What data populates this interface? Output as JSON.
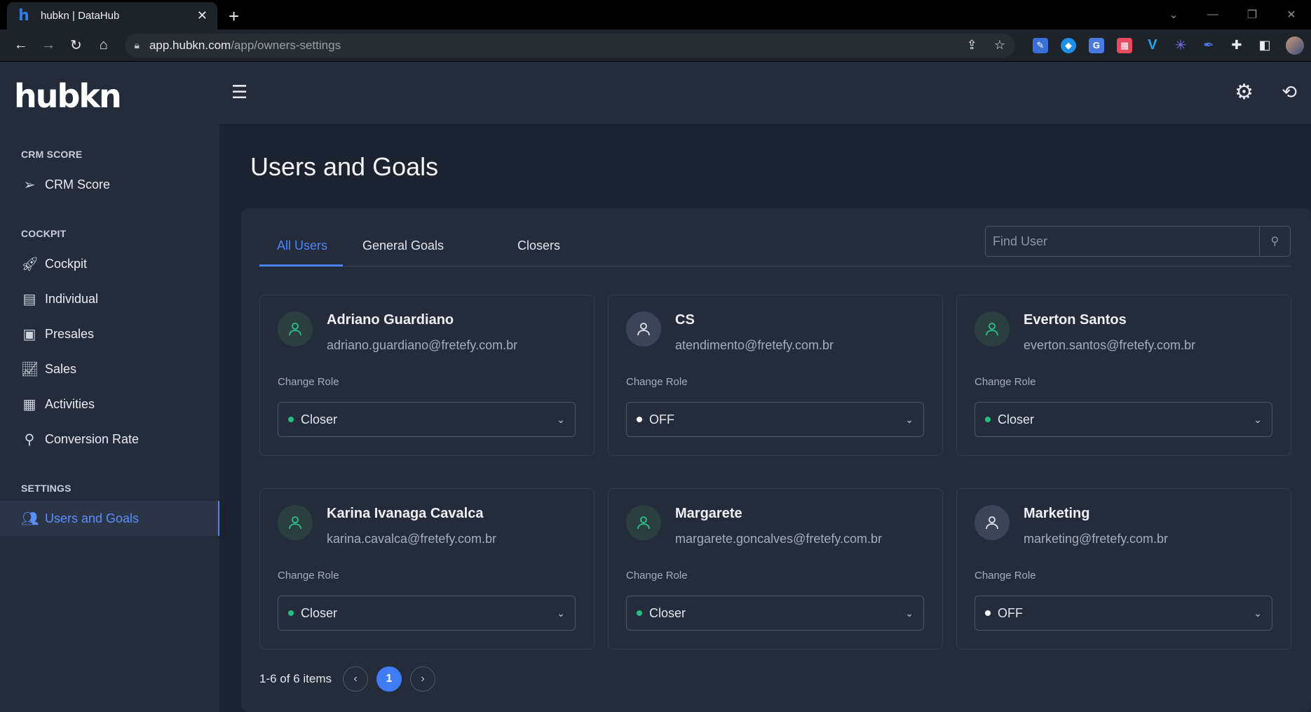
{
  "browser": {
    "tab_title": "hubkn | DataHub",
    "url_host": "app.hubkn.com",
    "url_path": "/app/owners-settings"
  },
  "app": {
    "logo": "hubkn"
  },
  "sidebar": {
    "sections": [
      {
        "title": "CRM SCORE",
        "items": [
          {
            "label": "CRM Score",
            "icon": "send-icon"
          }
        ]
      },
      {
        "title": "COCKPIT",
        "items": [
          {
            "label": "Cockpit",
            "icon": "rocket-icon"
          },
          {
            "label": "Individual",
            "icon": "clipboard-icon"
          },
          {
            "label": "Presales",
            "icon": "contact-card-icon"
          },
          {
            "label": "Sales",
            "icon": "line-chart-icon"
          },
          {
            "label": "Activities",
            "icon": "calendar-check-icon"
          },
          {
            "label": "Conversion Rate",
            "icon": "search-chart-icon"
          }
        ]
      },
      {
        "title": "SETTINGS",
        "items": [
          {
            "label": "Users and Goals",
            "icon": "users-icon",
            "active": true
          }
        ]
      }
    ]
  },
  "page": {
    "title": "Users and Goals",
    "tabs": [
      "All Users",
      "General Goals",
      "Closers"
    ],
    "search_placeholder": "Find User"
  },
  "users": [
    {
      "name": "Adriano Guardiano",
      "email": "adriano.guardiano@fretefy.com.br",
      "role_label": "Change Role",
      "role": "Closer",
      "avatar": "green"
    },
    {
      "name": "CS",
      "email": "atendimento@fretefy.com.br",
      "role_label": "Change Role",
      "role": "OFF",
      "avatar": "gray"
    },
    {
      "name": "Everton Santos",
      "email": "everton.santos@fretefy.com.br",
      "role_label": "Change Role",
      "role": "Closer",
      "avatar": "green"
    },
    {
      "name": "Karina Ivanaga Cavalca",
      "email": "karina.cavalca@fretefy.com.br",
      "role_label": "Change Role",
      "role": "Closer",
      "avatar": "green"
    },
    {
      "name": "Margarete",
      "email": "margarete.goncalves@fretefy.com.br",
      "role_label": "Change Role",
      "role": "Closer",
      "avatar": "green"
    },
    {
      "name": "Marketing",
      "email": "marketing@fretefy.com.br",
      "role_label": "Change Role",
      "role": "OFF",
      "avatar": "gray"
    }
  ],
  "pagination": {
    "summary": "1-6 of 6 items",
    "current": "1"
  },
  "colors": {
    "accent": "#4d84f5",
    "closer_dot": "#22c07e",
    "off_dot": "#ffffff"
  }
}
